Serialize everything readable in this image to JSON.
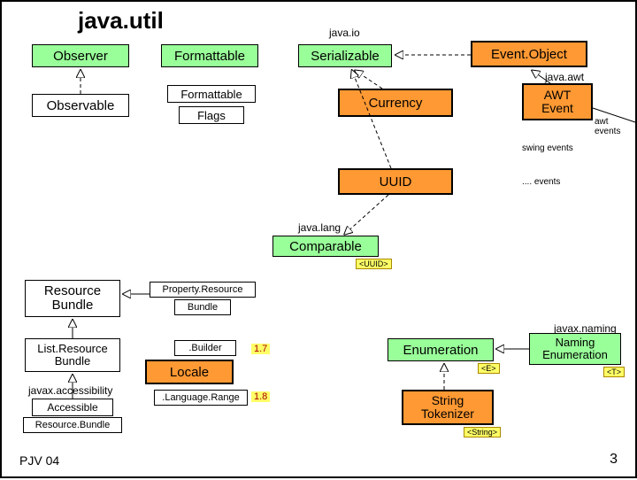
{
  "title": "java.util",
  "pkg": {
    "io": "java.io",
    "awt": "java.awt",
    "lang": "java.lang",
    "naming": "javax.naming",
    "accessibility": "javax.accessibility"
  },
  "nodes": {
    "observer": "Observer",
    "formattable": "Formattable",
    "serializable": "Serializable",
    "eventObject": "Event.Object",
    "observable": "Observable",
    "formattable2": "Formattable",
    "flags": "Flags",
    "currency": "Currency",
    "awtEvent": "AWT Event",
    "uuid": "UUID",
    "comparable": "Comparable",
    "resourceBundle": "Resource Bundle",
    "propertyResource": "Property.Resource",
    "bundle": "Bundle",
    "listResourceBundle": "List.Resource Bundle",
    "builder": ".Builder",
    "locale": "Locale",
    "languageRange": ".Language.Range",
    "accessible": "Accessible",
    "resourceBundle2": "Resource.Bundle",
    "enumeration": "Enumeration",
    "namingEnumeration": "Naming Enumeration",
    "stringTokenizer": "String Tokenizer"
  },
  "tags": {
    "uuid": "<UUID>",
    "e": "<E>",
    "t": "<T>",
    "string": "<String>"
  },
  "labels": {
    "swingEvents": "swing events",
    "dotEvents": ".... events",
    "awtEvents": "awt events"
  },
  "versions": {
    "v17": "1.7",
    "v18": "1.8"
  },
  "footer": {
    "left": "PJV 04",
    "right": "3"
  }
}
